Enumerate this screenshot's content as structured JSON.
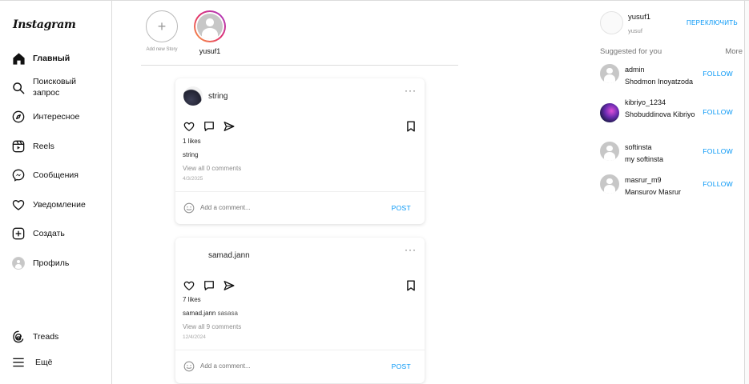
{
  "app": {
    "logo": "Instagram"
  },
  "nav": [
    {
      "label": "Главный",
      "icon": "home-icon",
      "active": true
    },
    {
      "label": "Поисковый запрос",
      "icon": "search-icon"
    },
    {
      "label": "Интересное",
      "icon": "explore-icon"
    },
    {
      "label": "Reels",
      "icon": "reels-icon"
    },
    {
      "label": "Сообщения",
      "icon": "messenger-icon"
    },
    {
      "label": "Уведомление",
      "icon": "heart-icon"
    },
    {
      "label": "Создать",
      "icon": "create-icon"
    },
    {
      "label": "Профиль",
      "icon": "profile-avatar"
    },
    {
      "label": "Treads",
      "icon": "threads-icon"
    },
    {
      "label": "Ещё",
      "icon": "menu-icon"
    }
  ],
  "stories": {
    "add_label": "Add new Story",
    "items": [
      {
        "username": "yusuf1"
      }
    ]
  },
  "posts": [
    {
      "username": "string",
      "likes": "1 likes",
      "caption_user": "",
      "caption_text": "string",
      "view_comments": "View all 0 comments",
      "date": "4/3/2025",
      "comment_placeholder": "Add a comment...",
      "post_label": "POST"
    },
    {
      "username": "samad.jann",
      "likes": "7 likes",
      "caption_user": "samad.jann",
      "caption_text": "sasasa",
      "view_comments": "View all 9 comments",
      "date": "12/4/2024",
      "comment_placeholder": "Add a comment...",
      "post_label": "POST"
    }
  ],
  "right": {
    "username": "yusuf1",
    "name": "yusuf",
    "switch_label": "ПЕРЕКЛЮЧИТЬ",
    "suggested_title": "Suggested for you",
    "more_label": "More",
    "follow_label": "FOLLOW",
    "suggestions": [
      {
        "username": "admin",
        "name": "Shodmon Inoyatzoda"
      },
      {
        "username": "kibriyo_1234",
        "name": "Shobuddinova Kibriyo"
      },
      {
        "username": "softinsta",
        "name": "my softinsta"
      },
      {
        "username": "masrur_m9",
        "name": "Mansurov Masrur"
      }
    ]
  },
  "colors": {
    "accent": "#0095f6",
    "border": "#dbdbdb",
    "muted": "#8e8e8e"
  }
}
